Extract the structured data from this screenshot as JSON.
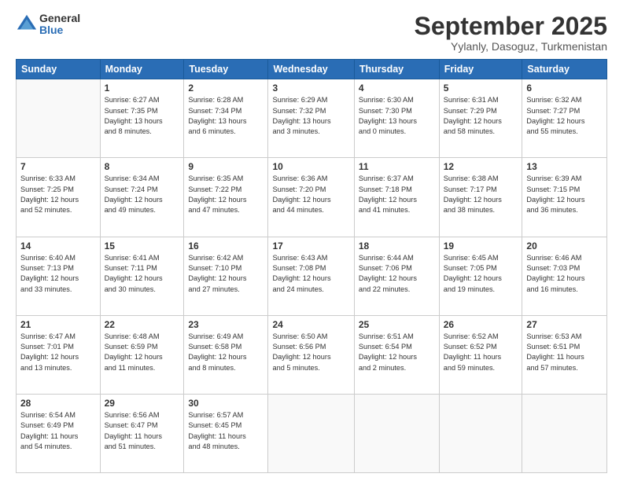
{
  "header": {
    "logo_line1": "General",
    "logo_line2": "Blue",
    "month": "September 2025",
    "location": "Yylanly, Dasoguz, Turkmenistan"
  },
  "days_of_week": [
    "Sunday",
    "Monday",
    "Tuesday",
    "Wednesday",
    "Thursday",
    "Friday",
    "Saturday"
  ],
  "weeks": [
    [
      {
        "num": "",
        "info": ""
      },
      {
        "num": "1",
        "info": "Sunrise: 6:27 AM\nSunset: 7:35 PM\nDaylight: 13 hours\nand 8 minutes."
      },
      {
        "num": "2",
        "info": "Sunrise: 6:28 AM\nSunset: 7:34 PM\nDaylight: 13 hours\nand 6 minutes."
      },
      {
        "num": "3",
        "info": "Sunrise: 6:29 AM\nSunset: 7:32 PM\nDaylight: 13 hours\nand 3 minutes."
      },
      {
        "num": "4",
        "info": "Sunrise: 6:30 AM\nSunset: 7:30 PM\nDaylight: 13 hours\nand 0 minutes."
      },
      {
        "num": "5",
        "info": "Sunrise: 6:31 AM\nSunset: 7:29 PM\nDaylight: 12 hours\nand 58 minutes."
      },
      {
        "num": "6",
        "info": "Sunrise: 6:32 AM\nSunset: 7:27 PM\nDaylight: 12 hours\nand 55 minutes."
      }
    ],
    [
      {
        "num": "7",
        "info": "Sunrise: 6:33 AM\nSunset: 7:25 PM\nDaylight: 12 hours\nand 52 minutes."
      },
      {
        "num": "8",
        "info": "Sunrise: 6:34 AM\nSunset: 7:24 PM\nDaylight: 12 hours\nand 49 minutes."
      },
      {
        "num": "9",
        "info": "Sunrise: 6:35 AM\nSunset: 7:22 PM\nDaylight: 12 hours\nand 47 minutes."
      },
      {
        "num": "10",
        "info": "Sunrise: 6:36 AM\nSunset: 7:20 PM\nDaylight: 12 hours\nand 44 minutes."
      },
      {
        "num": "11",
        "info": "Sunrise: 6:37 AM\nSunset: 7:18 PM\nDaylight: 12 hours\nand 41 minutes."
      },
      {
        "num": "12",
        "info": "Sunrise: 6:38 AM\nSunset: 7:17 PM\nDaylight: 12 hours\nand 38 minutes."
      },
      {
        "num": "13",
        "info": "Sunrise: 6:39 AM\nSunset: 7:15 PM\nDaylight: 12 hours\nand 36 minutes."
      }
    ],
    [
      {
        "num": "14",
        "info": "Sunrise: 6:40 AM\nSunset: 7:13 PM\nDaylight: 12 hours\nand 33 minutes."
      },
      {
        "num": "15",
        "info": "Sunrise: 6:41 AM\nSunset: 7:11 PM\nDaylight: 12 hours\nand 30 minutes."
      },
      {
        "num": "16",
        "info": "Sunrise: 6:42 AM\nSunset: 7:10 PM\nDaylight: 12 hours\nand 27 minutes."
      },
      {
        "num": "17",
        "info": "Sunrise: 6:43 AM\nSunset: 7:08 PM\nDaylight: 12 hours\nand 24 minutes."
      },
      {
        "num": "18",
        "info": "Sunrise: 6:44 AM\nSunset: 7:06 PM\nDaylight: 12 hours\nand 22 minutes."
      },
      {
        "num": "19",
        "info": "Sunrise: 6:45 AM\nSunset: 7:05 PM\nDaylight: 12 hours\nand 19 minutes."
      },
      {
        "num": "20",
        "info": "Sunrise: 6:46 AM\nSunset: 7:03 PM\nDaylight: 12 hours\nand 16 minutes."
      }
    ],
    [
      {
        "num": "21",
        "info": "Sunrise: 6:47 AM\nSunset: 7:01 PM\nDaylight: 12 hours\nand 13 minutes."
      },
      {
        "num": "22",
        "info": "Sunrise: 6:48 AM\nSunset: 6:59 PM\nDaylight: 12 hours\nand 11 minutes."
      },
      {
        "num": "23",
        "info": "Sunrise: 6:49 AM\nSunset: 6:58 PM\nDaylight: 12 hours\nand 8 minutes."
      },
      {
        "num": "24",
        "info": "Sunrise: 6:50 AM\nSunset: 6:56 PM\nDaylight: 12 hours\nand 5 minutes."
      },
      {
        "num": "25",
        "info": "Sunrise: 6:51 AM\nSunset: 6:54 PM\nDaylight: 12 hours\nand 2 minutes."
      },
      {
        "num": "26",
        "info": "Sunrise: 6:52 AM\nSunset: 6:52 PM\nDaylight: 11 hours\nand 59 minutes."
      },
      {
        "num": "27",
        "info": "Sunrise: 6:53 AM\nSunset: 6:51 PM\nDaylight: 11 hours\nand 57 minutes."
      }
    ],
    [
      {
        "num": "28",
        "info": "Sunrise: 6:54 AM\nSunset: 6:49 PM\nDaylight: 11 hours\nand 54 minutes."
      },
      {
        "num": "29",
        "info": "Sunrise: 6:56 AM\nSunset: 6:47 PM\nDaylight: 11 hours\nand 51 minutes."
      },
      {
        "num": "30",
        "info": "Sunrise: 6:57 AM\nSunset: 6:45 PM\nDaylight: 11 hours\nand 48 minutes."
      },
      {
        "num": "",
        "info": ""
      },
      {
        "num": "",
        "info": ""
      },
      {
        "num": "",
        "info": ""
      },
      {
        "num": "",
        "info": ""
      }
    ]
  ]
}
